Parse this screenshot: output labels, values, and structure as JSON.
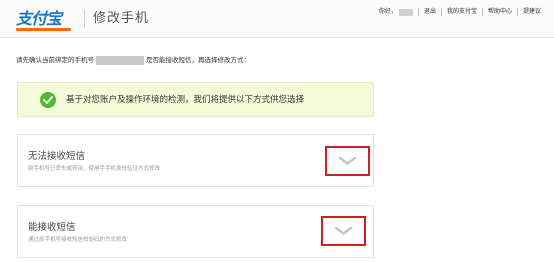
{
  "header": {
    "logo_text": "支付宝",
    "page_title": "修改手机",
    "nav": {
      "greeting": "你好，",
      "logout": "退出",
      "my_alipay": "我的支付宝",
      "help_center": "帮助中心",
      "feedback": "提建议"
    }
  },
  "notice": {
    "prefix": "请先确认当前绑定的手机号",
    "suffix": "是否能接收短信，再选择修改方式："
  },
  "info_box": {
    "text": "基于对您账户及操作环境的检测，我们将提供以下方式供您选择"
  },
  "options": [
    {
      "title": "无法接收短信",
      "description": "原手机号已丢失或停用，使用手手机身份验证方式修改"
    },
    {
      "title": "能接收短信",
      "description": "通过原手机号接收短信校验码的方式修改"
    }
  ],
  "colors": {
    "logo_blue": "#1a77c9",
    "logo_orange": "#ff6600",
    "success_green": "#50b833",
    "info_bg": "#f5fbd9",
    "highlight_red": "#cc2222"
  }
}
